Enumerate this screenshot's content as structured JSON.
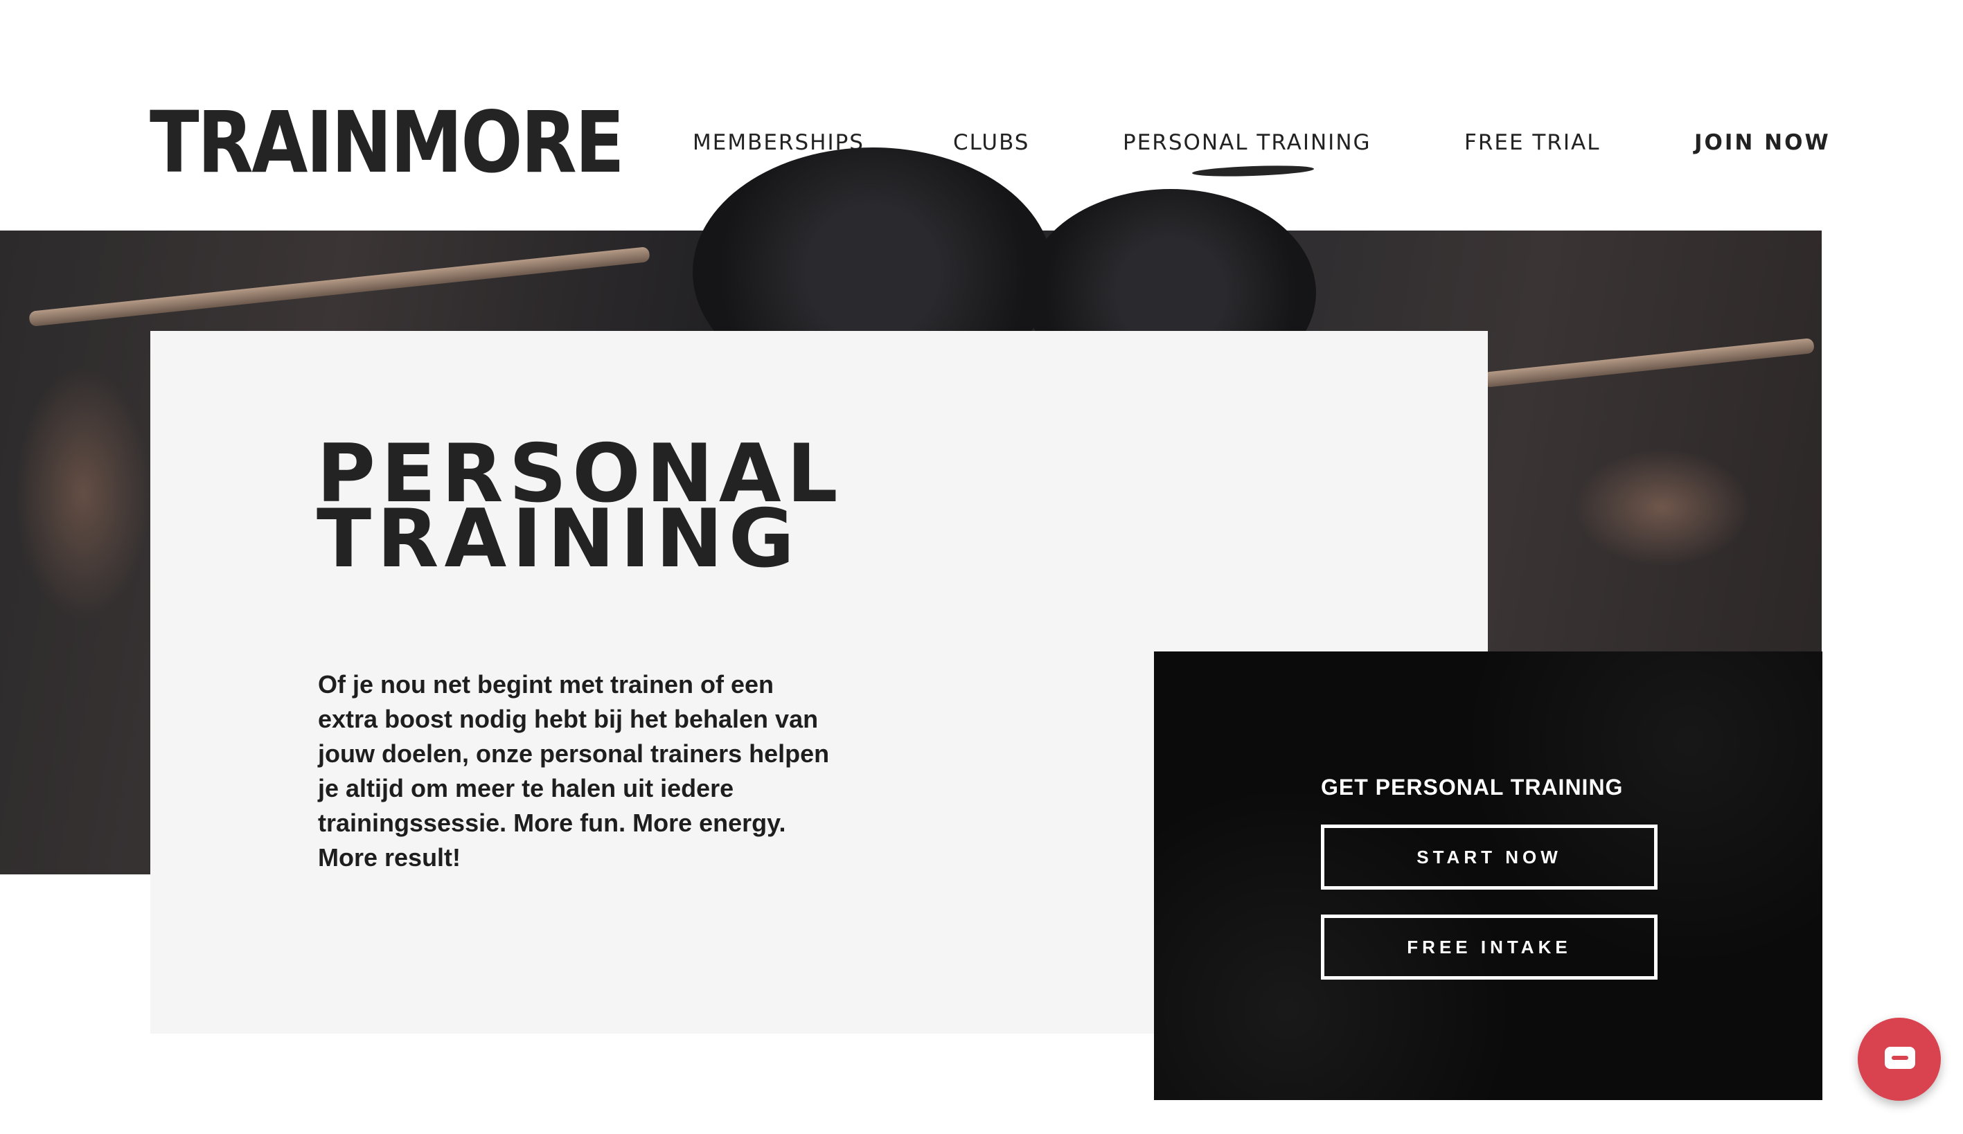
{
  "header": {
    "logo": "TRAINMORE",
    "nav": {
      "memberships": "MEMBERSHIPS",
      "clubs": "CLUBS",
      "personal_training": "PERSONAL TRAINING",
      "free_trial": "FREE TRIAL",
      "join_now": "JOIN NOW"
    }
  },
  "hero": {
    "title_line1": "PERSONAL",
    "title_line2": "TRAINING",
    "intro": "Of je nou net begint met trainen of een extra boost nodig hebt bij het behalen van jouw doelen, onze personal trainers helpen je altijd om meer te halen uit iedere trainingssessie. More fun. More energy. More result!"
  },
  "cta": {
    "heading": "GET PERSONAL TRAINING",
    "start_label": "START NOW",
    "intake_label": "FREE INTAKE"
  },
  "chat": {
    "icon": "chat-icon",
    "color": "#d94350"
  }
}
